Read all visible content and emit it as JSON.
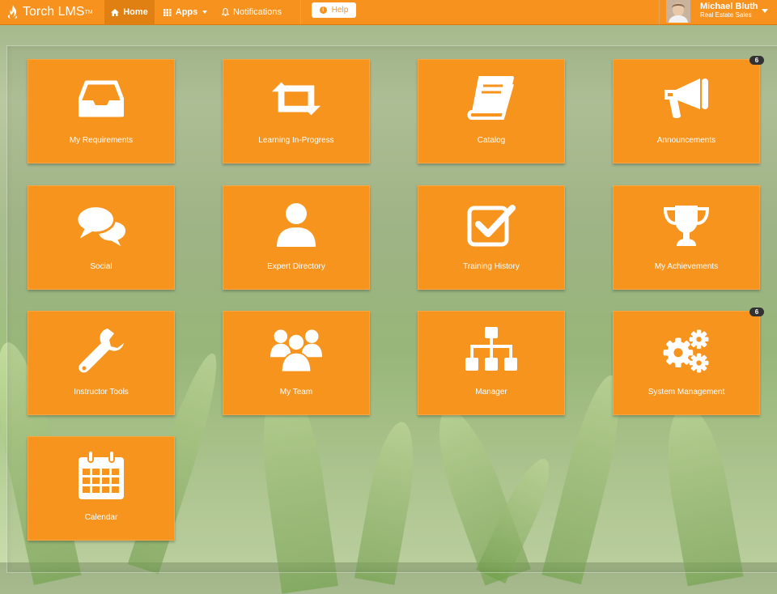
{
  "app": {
    "logo_text": "Torch LMS",
    "logo_tm": "TM"
  },
  "nav": {
    "home": "Home",
    "apps": "Apps",
    "notifications": "Notifications",
    "help": "Help"
  },
  "user": {
    "name": "Michael Bluth",
    "role": "Real Estate Sales"
  },
  "colors": {
    "brand": "#f7921e",
    "tile": "#f7941d",
    "badge": "#333333"
  },
  "tiles": [
    {
      "label": "My Requirements",
      "icon": "inbox-icon"
    },
    {
      "label": "Learning In-Progress",
      "icon": "retweet-icon"
    },
    {
      "label": "Catalog",
      "icon": "book-icon"
    },
    {
      "label": "Announcements",
      "icon": "megaphone-icon",
      "badge": "6"
    },
    {
      "label": "Social",
      "icon": "chat-bubbles-icon"
    },
    {
      "label": "Expert Directory",
      "icon": "user-icon"
    },
    {
      "label": "Training History",
      "icon": "checkbox-icon"
    },
    {
      "label": "My Achievements",
      "icon": "trophy-icon"
    },
    {
      "label": "Instructor Tools",
      "icon": "wrench-icon"
    },
    {
      "label": "My Team",
      "icon": "group-icon"
    },
    {
      "label": "Manager",
      "icon": "org-chart-icon"
    },
    {
      "label": "System Management",
      "icon": "gears-icon",
      "badge": "6"
    },
    {
      "label": "Calendar",
      "icon": "calendar-icon"
    }
  ]
}
